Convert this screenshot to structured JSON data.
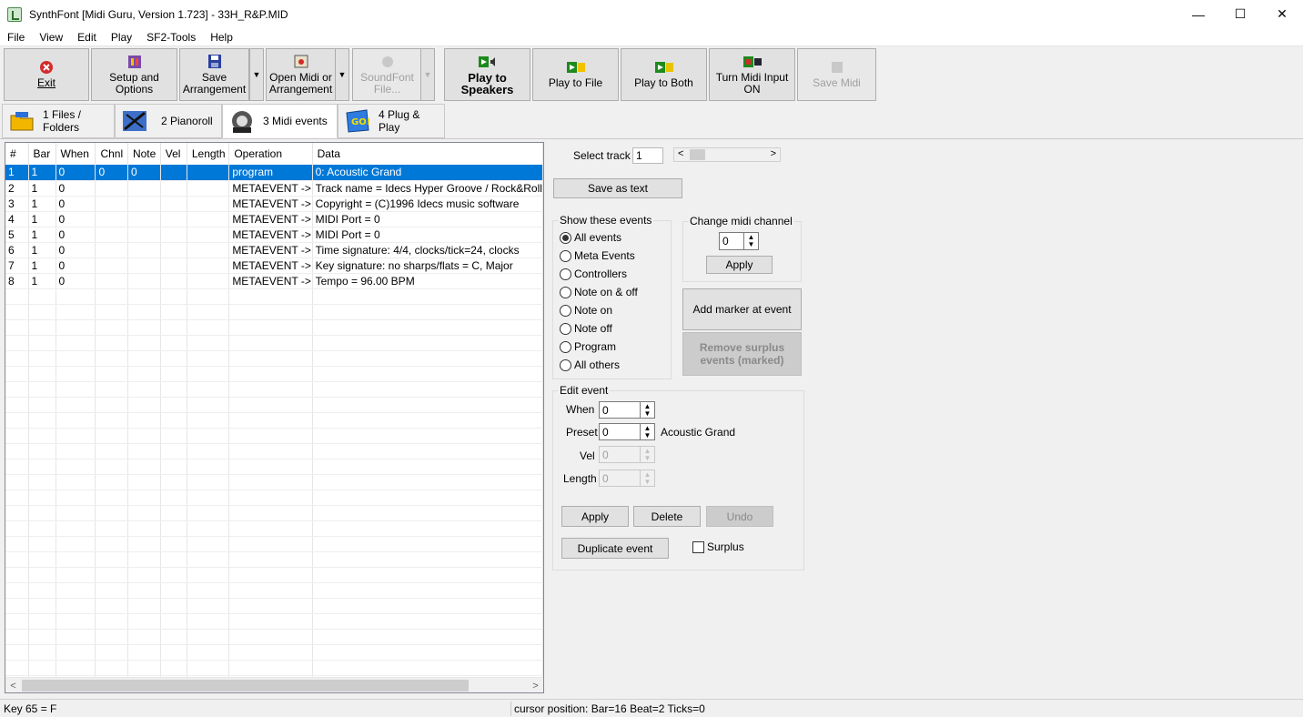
{
  "window": {
    "title": "SynthFont [Midi Guru, Version 1.723] - 33H_R&P.MID",
    "minimize": "—",
    "maximize": "☐",
    "close": "✕"
  },
  "menu": [
    "File",
    "View",
    "Edit",
    "Play",
    "SF2-Tools",
    "Help"
  ],
  "toolbar": {
    "exit": "Exit",
    "setup": "Setup and Options",
    "save_line1": "Save",
    "save_line2": "Arrangement",
    "open_line1": "Open Midi or",
    "open_line2": "Arrangement",
    "soundfont_line1": "SoundFont",
    "soundfont_line2": "File...",
    "play_speakers_line1": "Play to",
    "play_speakers_line2": "Speakers",
    "play_file": "Play to File",
    "play_both": "Play to Both",
    "midi_input": "Turn Midi Input ON",
    "save_midi": "Save Midi",
    "dropdown": "▼"
  },
  "tabs": [
    "1 Files / Folders",
    "2 Pianoroll",
    "3 Midi events",
    "4 Plug & Play"
  ],
  "grid": {
    "columns": [
      "#",
      "Bar",
      "When",
      "Chnl",
      "Note",
      "Vel",
      "Length",
      "Operation",
      "Data"
    ],
    "rows": [
      [
        "1",
        "1",
        "0",
        "0",
        "0",
        "",
        "",
        "program",
        "0: Acoustic Grand"
      ],
      [
        "2",
        "1",
        "0",
        "",
        "",
        "",
        "",
        "METAEVENT ->",
        "Track name = Idecs Hyper Groove / Rock&Roll"
      ],
      [
        "3",
        "1",
        "0",
        "",
        "",
        "",
        "",
        "METAEVENT ->",
        "Copyright = (C)1996 Idecs music software"
      ],
      [
        "4",
        "1",
        "0",
        "",
        "",
        "",
        "",
        "METAEVENT ->",
        "MIDI Port = 0"
      ],
      [
        "5",
        "1",
        "0",
        "",
        "",
        "",
        "",
        "METAEVENT ->",
        "MIDI Port = 0"
      ],
      [
        "6",
        "1",
        "0",
        "",
        "",
        "",
        "",
        "METAEVENT ->",
        "Time signature:  4/4, clocks/tick=24, clocks"
      ],
      [
        "7",
        "1",
        "0",
        "",
        "",
        "",
        "",
        "METAEVENT ->",
        "Key signature: no sharps/flats = C, Major"
      ],
      [
        "8",
        "1",
        "0",
        "",
        "",
        "",
        "",
        "METAEVENT ->",
        "Tempo = 96.00 BPM"
      ]
    ],
    "selected_row": 0,
    "scroll_left": "<",
    "scroll_right": ">"
  },
  "right": {
    "select_track_label": "Select track",
    "select_track_value": "1",
    "track_left": "<",
    "track_right": ">",
    "save_as_text": "Save as text",
    "show_events": {
      "title": "Show these events",
      "options": [
        "All events",
        "Meta Events",
        "Controllers",
        "Note on & off",
        "Note on",
        "Note off",
        "Program",
        "All others"
      ],
      "selected": 0
    },
    "change_channel": {
      "title": "Change midi channel",
      "value": "0",
      "apply": "Apply"
    },
    "add_marker": "Add marker at event",
    "remove_surplus_line1": "Remove surplus",
    "remove_surplus_line2": "events (marked)",
    "edit_event": {
      "title": "Edit event",
      "when_label": "When",
      "when_value": "0",
      "preset_label": "Preset",
      "preset_value": "0",
      "preset_name": "Acoustic Grand",
      "vel_label": "Vel",
      "vel_value": "0",
      "length_label": "Length",
      "length_value": "0",
      "apply": "Apply",
      "delete": "Delete",
      "undo": "Undo",
      "duplicate": "Duplicate event",
      "surplus": "Surplus"
    }
  },
  "status": {
    "left": "Key 65 = F",
    "right": "cursor position: Bar=16 Beat=2 Ticks=0"
  },
  "colors": {
    "selection": "#0078d7",
    "button_face": "#e1e1e1"
  }
}
